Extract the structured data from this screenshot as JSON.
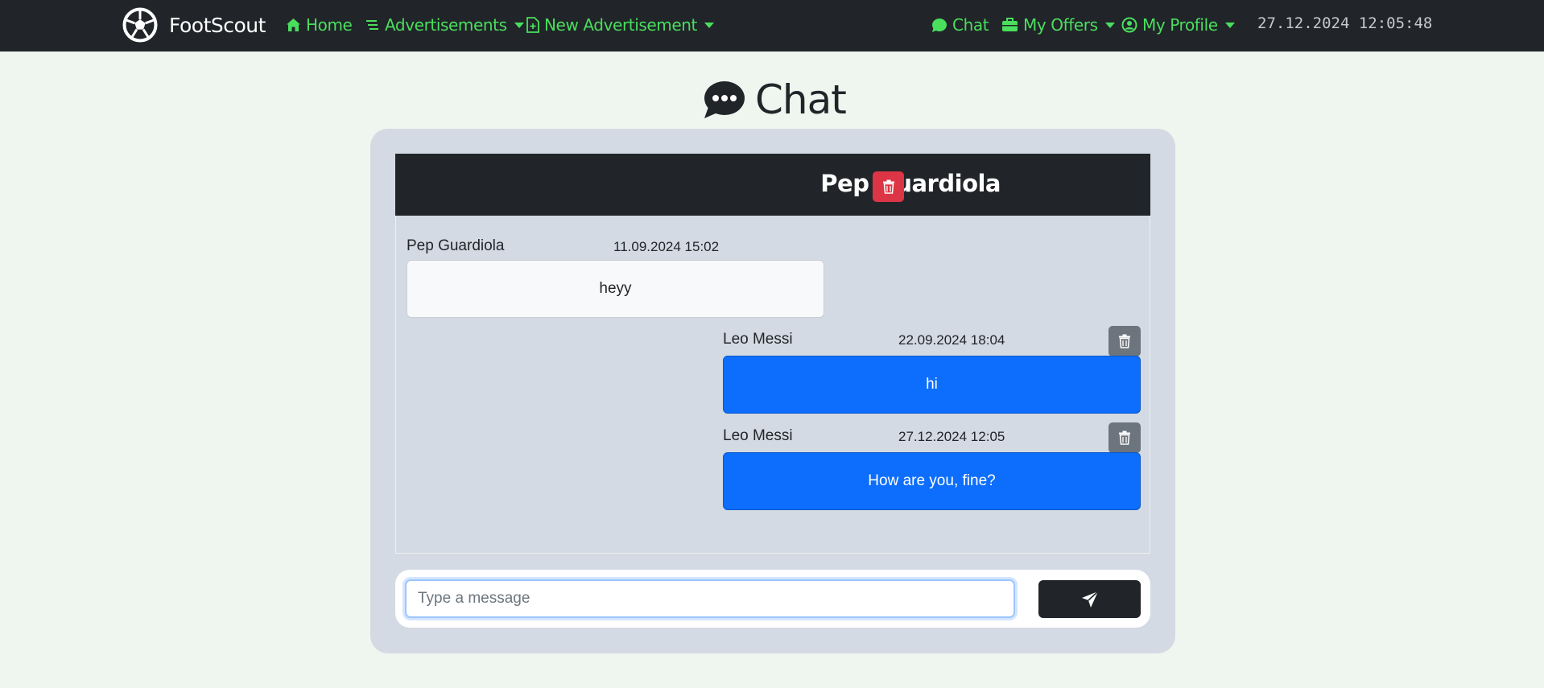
{
  "navbar": {
    "brand": "FootScout",
    "home_label": "Home",
    "advertisements_label": "Advertisements",
    "new_advertisement_label": "New Advertisement",
    "chat_label": "Chat",
    "my_offers_label": "My Offers",
    "my_profile_label": "My Profile",
    "clock": "27.12.2024 12:05:48",
    "accent_color": "#4ade5e"
  },
  "page": {
    "title": "Chat",
    "title_icon": "chat-dots-icon"
  },
  "chat": {
    "partner_name": "Pep Guardiola",
    "delete_icon": "trash-icon",
    "messages": [
      {
        "sender": "Pep Guardiola",
        "time": "11.09.2024 15:02",
        "text": "heyy",
        "direction": "incoming"
      },
      {
        "sender": "Leo Messi",
        "time": "22.09.2024 18:04",
        "text": "hi",
        "direction": "outgoing"
      },
      {
        "sender": "Leo Messi",
        "time": "27.12.2024 12:05",
        "text": "How are you, fine?",
        "direction": "outgoing"
      }
    ],
    "input_placeholder": "Type a message",
    "input_value": "",
    "send_icon": "send-icon",
    "outgoing_color": "#0d6efd",
    "danger_color": "#dc3545"
  }
}
